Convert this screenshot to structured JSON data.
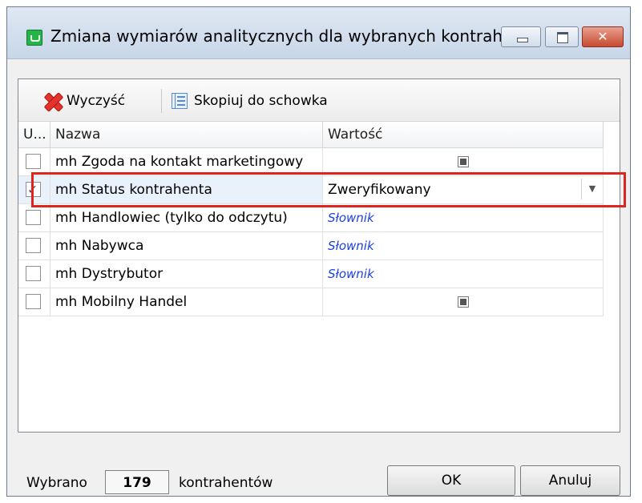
{
  "window": {
    "title": "Zmiana wymiarów analitycznych dla wybranych kontrah...",
    "minimize_icon": "minimize-icon",
    "maximize_icon": "maximize-icon",
    "close_icon": "close-icon",
    "close_glyph": "✕"
  },
  "toolbar": {
    "clear_label": "Wyczyść",
    "copy_label": "Skopiuj do schowka"
  },
  "grid": {
    "columns": [
      "U...",
      "Nazwa",
      "Wartość"
    ],
    "rows": [
      {
        "checked": false,
        "name": "mh Zgoda na kontakt marketingowy",
        "value": "",
        "value_type": "checkbox"
      },
      {
        "checked": true,
        "name": "mh Status kontrahenta",
        "value": "Zweryfikowany",
        "value_type": "dropdown"
      },
      {
        "checked": false,
        "name": "mh Handlowiec (tylko do odczytu)",
        "value": "Słownik",
        "value_type": "link"
      },
      {
        "checked": false,
        "name": "mh Nabywca",
        "value": "Słownik",
        "value_type": "link"
      },
      {
        "checked": false,
        "name": "mh Dystrybutor",
        "value": "Słownik",
        "value_type": "link"
      },
      {
        "checked": false,
        "name": "mh Mobilny Handel",
        "value": "",
        "value_type": "checkbox"
      }
    ]
  },
  "status": {
    "selected_label": "Wybrano",
    "count": "179",
    "suffix_label": "kontrahentów"
  },
  "buttons": {
    "ok_label": "OK",
    "cancel_label": "Anuluj"
  },
  "colors": {
    "highlight": "#e0231d",
    "link": "#1a3fe8"
  }
}
